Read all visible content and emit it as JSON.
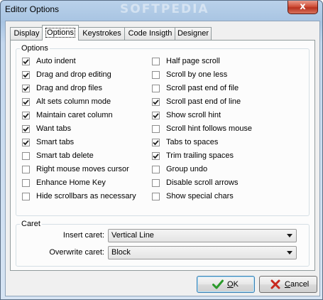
{
  "window": {
    "title": "Editor Options",
    "watermark": "SOFTPEDIA",
    "close_glyph": "x"
  },
  "tabs": [
    {
      "label": "Display",
      "active": false
    },
    {
      "label": "Options",
      "active": true
    },
    {
      "label": "Keystrokes",
      "active": false
    },
    {
      "label": "Code Insigth",
      "active": false
    },
    {
      "label": "Designer",
      "active": false
    }
  ],
  "options_group": {
    "label": "Options",
    "left_column": [
      {
        "label": "Auto indent",
        "checked": true
      },
      {
        "label": "Drag and drop editing",
        "checked": true
      },
      {
        "label": "Drag and drop files",
        "checked": true
      },
      {
        "label": "Alt sets column mode",
        "checked": true
      },
      {
        "label": "Maintain caret column",
        "checked": true
      },
      {
        "label": "Want tabs",
        "checked": true
      },
      {
        "label": "Smart tabs",
        "checked": true
      },
      {
        "label": "Smart tab delete",
        "checked": false
      },
      {
        "label": "Right mouse moves cursor",
        "checked": false
      },
      {
        "label": "Enhance Home Key",
        "checked": false
      },
      {
        "label": "Hide scrollbars as necessary",
        "checked": false
      }
    ],
    "right_column": [
      {
        "label": "Half page scroll",
        "checked": false
      },
      {
        "label": "Scroll by one less",
        "checked": false
      },
      {
        "label": "Scroll past end of file",
        "checked": false
      },
      {
        "label": "Scroll past end of line",
        "checked": true
      },
      {
        "label": "Show scroll hint",
        "checked": true
      },
      {
        "label": "Scroll hint follows mouse",
        "checked": false
      },
      {
        "label": "Tabs to spaces",
        "checked": true
      },
      {
        "label": "Trim trailing spaces",
        "checked": true
      },
      {
        "label": "Group undo",
        "checked": false
      },
      {
        "label": "Disable scroll arrows",
        "checked": false
      },
      {
        "label": "Show special chars",
        "checked": false
      }
    ]
  },
  "caret_group": {
    "label": "Caret",
    "insert_label": "Insert caret:",
    "insert_value": "Vertical Line",
    "overwrite_label": "Overwrite caret:",
    "overwrite_value": "Block"
  },
  "buttons": {
    "ok_label": "OK",
    "ok_icon": "checkmark-icon",
    "cancel_label": "Cancel",
    "cancel_icon": "cross-icon"
  },
  "colors": {
    "check_mark": "#1c1c1c",
    "ok_icon": "#2a9a2a",
    "cancel_icon": "#c8281e"
  }
}
